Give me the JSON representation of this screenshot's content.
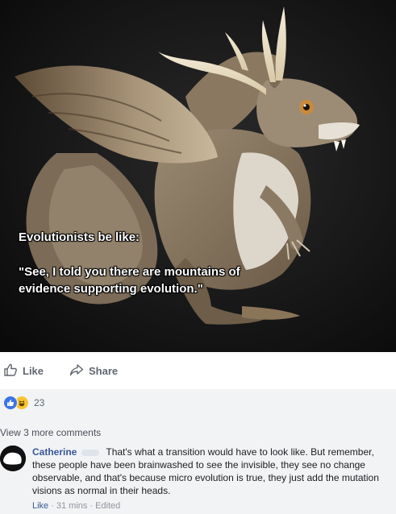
{
  "post": {
    "image": {
      "caption_line1": "Evolutionists be like:",
      "caption_quote": "\"See, I told you there are mountains of evidence supporting evolution.\""
    },
    "actions": {
      "like_label": "Like",
      "share_label": "Share"
    },
    "reactions": {
      "count": "23",
      "types": [
        "like",
        "haha"
      ]
    }
  },
  "comments": {
    "view_more": "View 3 more comments",
    "items": [
      {
        "author": "Catherine",
        "text": "That's what a transition would have to look like. But remember, these people have been brainwashed to see the invisible, they see no change observable, and that's because micro evolution is true, they just add the mutation visions as normal in their heads.",
        "like_label": "Like",
        "time": "31 mins",
        "edited": "Edited"
      }
    ]
  },
  "colors": {
    "link": "#385898",
    "muted": "#90949c",
    "action_text": "#606770",
    "comment_bg": "#f2f3f5",
    "like_blue": "#3b74e6",
    "haha_yellow": "#f7c431"
  },
  "icons": {
    "like": "thumbs-up-icon",
    "share": "share-arrow-icon",
    "reaction_like": "reaction-like-icon",
    "reaction_haha": "reaction-haha-icon"
  }
}
